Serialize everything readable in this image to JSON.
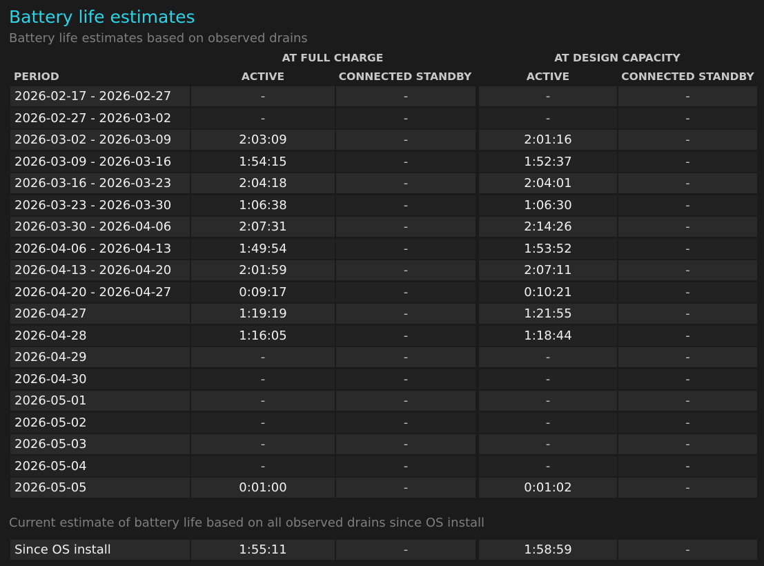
{
  "section": {
    "title": "Battery life estimates",
    "subtitle": "Battery life estimates based on observed drains"
  },
  "table": {
    "group_full_charge": "AT FULL CHARGE",
    "group_design_capacity": "AT DESIGN CAPACITY",
    "headers": {
      "period": "PERIOD",
      "fc_active": "ACTIVE",
      "fc_standby": "CONNECTED STANDBY",
      "dc_active": "ACTIVE",
      "dc_standby": "CONNECTED STANDBY"
    },
    "rows": [
      {
        "period": "2026-02-17 - 2026-02-27",
        "fc_active": "-",
        "fc_standby": "-",
        "dc_active": "-",
        "dc_standby": "-"
      },
      {
        "period": "2026-02-27 - 2026-03-02",
        "fc_active": "-",
        "fc_standby": "-",
        "dc_active": "-",
        "dc_standby": "-"
      },
      {
        "period": "2026-03-02 - 2026-03-09",
        "fc_active": "2:03:09",
        "fc_standby": "-",
        "dc_active": "2:01:16",
        "dc_standby": "-"
      },
      {
        "period": "2026-03-09 - 2026-03-16",
        "fc_active": "1:54:15",
        "fc_standby": "-",
        "dc_active": "1:52:37",
        "dc_standby": "-"
      },
      {
        "period": "2026-03-16 - 2026-03-23",
        "fc_active": "2:04:18",
        "fc_standby": "-",
        "dc_active": "2:04:01",
        "dc_standby": "-"
      },
      {
        "period": "2026-03-23 - 2026-03-30",
        "fc_active": "1:06:38",
        "fc_standby": "-",
        "dc_active": "1:06:30",
        "dc_standby": "-"
      },
      {
        "period": "2026-03-30 - 2026-04-06",
        "fc_active": "2:07:31",
        "fc_standby": "-",
        "dc_active": "2:14:26",
        "dc_standby": "-"
      },
      {
        "period": "2026-04-06 - 2026-04-13",
        "fc_active": "1:49:54",
        "fc_standby": "-",
        "dc_active": "1:53:52",
        "dc_standby": "-"
      },
      {
        "period": "2026-04-13 - 2026-04-20",
        "fc_active": "2:01:59",
        "fc_standby": "-",
        "dc_active": "2:07:11",
        "dc_standby": "-"
      },
      {
        "period": "2026-04-20 - 2026-04-27",
        "fc_active": "0:09:17",
        "fc_standby": "-",
        "dc_active": "0:10:21",
        "dc_standby": "-"
      },
      {
        "period": "2026-04-27",
        "fc_active": "1:19:19",
        "fc_standby": "-",
        "dc_active": "1:21:55",
        "dc_standby": "-"
      },
      {
        "period": "2026-04-28",
        "fc_active": "1:16:05",
        "fc_standby": "-",
        "dc_active": "1:18:44",
        "dc_standby": "-"
      },
      {
        "period": "2026-04-29",
        "fc_active": "-",
        "fc_standby": "-",
        "dc_active": "-",
        "dc_standby": "-"
      },
      {
        "period": "2026-04-30",
        "fc_active": "-",
        "fc_standby": "-",
        "dc_active": "-",
        "dc_standby": "-"
      },
      {
        "period": "2026-05-01",
        "fc_active": "-",
        "fc_standby": "-",
        "dc_active": "-",
        "dc_standby": "-"
      },
      {
        "period": "2026-05-02",
        "fc_active": "-",
        "fc_standby": "-",
        "dc_active": "-",
        "dc_standby": "-"
      },
      {
        "period": "2026-05-03",
        "fc_active": "-",
        "fc_standby": "-",
        "dc_active": "-",
        "dc_standby": "-"
      },
      {
        "period": "2026-05-04",
        "fc_active": "-",
        "fc_standby": "-",
        "dc_active": "-",
        "dc_standby": "-"
      },
      {
        "period": "2026-05-05",
        "fc_active": "0:01:00",
        "fc_standby": "-",
        "dc_active": "0:01:02",
        "dc_standby": "-"
      }
    ]
  },
  "current_estimate": {
    "label": "Current estimate of battery life based on all observed drains since OS install",
    "row": {
      "period": "Since OS install",
      "fc_active": "1:55:11",
      "fc_standby": "-",
      "dc_active": "1:58:59",
      "dc_standby": "-"
    }
  },
  "colors": {
    "title": "#2ad4e6",
    "background": "#1b1b1b",
    "row_light": "#2a2a2a",
    "row_dark": "#222222"
  }
}
